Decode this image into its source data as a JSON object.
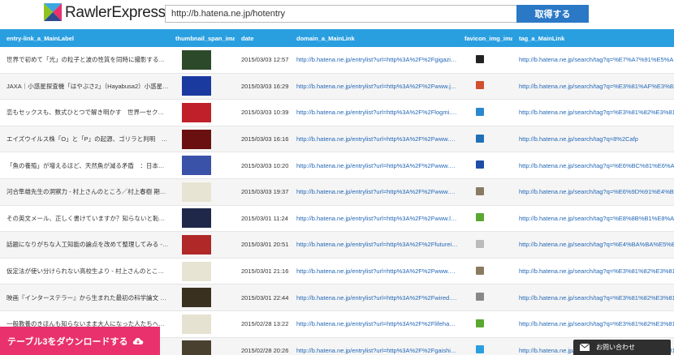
{
  "app": {
    "logo_text": "RawlerExpress",
    "logo_colors": [
      "#3aa7e0",
      "#e8316d",
      "#2d4b8e",
      "#8fc31f"
    ]
  },
  "search": {
    "url_value": "http://b.hatena.ne.jp/hotentry",
    "button_label": "取得する"
  },
  "table": {
    "columns": [
      "entry-link_a_MainLabel",
      "thumbnail_span_image",
      "date",
      "domain_a_MainLink",
      "favicon_img_image",
      "tag_a_MainLink"
    ],
    "rows": [
      {
        "label": "世界で初めて「光」の粒子と波の性質を同時に撮影することに成...",
        "thumb_color": "#2c4a2a",
        "date": "2015/03/03 12:57",
        "domain": "http://b.hatena.ne.jp/entrylist?url=http%3A%2F%2Fgigazine...",
        "favicon_icon": "gigazine-icon",
        "favicon_color": "#222222",
        "tag": "http://b.hatena.ne.jp/search/tag?q=%E7%A7%91%E5%AD%A6"
      },
      {
        "label": "JAXA｜小惑星探査機「はやぶさ2」（Hayabusa2）小惑星1999 ...",
        "thumb_color": "#1a3aa0",
        "date": "2015/03/03 16:29",
        "domain": "http://b.hatena.ne.jp/entrylist?url=http%3A%2F%2Fwww.jax...",
        "favicon_icon": "rocket-icon",
        "favicon_color": "#d05030",
        "tag": "http://b.hatena.ne.jp/search/tag?q=%E3%81%AF%E3%82%84"
      },
      {
        "label": "恋もセックスも、数式ひとつで解き明かす　世界一セクシーな数...",
        "thumb_color": "#c0202a",
        "date": "2015/03/03 10:39",
        "domain": "http://b.hatena.ne.jp/entrylist?url=http%3A%2F%2Flogmi.jp...",
        "favicon_icon": "logmi-icon",
        "favicon_color": "#2a88d0",
        "tag": "http://b.hatena.ne.jp/search/tag?q=%E3%81%82%E3%81%A8"
      },
      {
        "label": "エイズウイルス株「O」と「P」の起源、ゴリラと判明　写真1枚...",
        "thumb_color": "#6a1010",
        "date": "2015/03/03 16:16",
        "domain": "http://b.hatena.ne.jp/entrylist?url=http%3A%2F%2Fwww.afp...",
        "favicon_icon": "afp-icon",
        "favicon_color": "#1f6fb8",
        "tag": "http://b.hatena.ne.jp/search/tag?q=8%2Cafp"
      },
      {
        "label": "「魚の養殖」が増えるほど、天然魚が減る矛盾　：日本経済新聞",
        "thumb_color": "#3a52a8",
        "date": "2015/03/03 10:20",
        "domain": "http://b.hatena.ne.jp/entrylist?url=http%3A%2F%2Fwww.nik...",
        "favicon_icon": "nikkei-icon",
        "favicon_color": "#1e4ea8",
        "tag": "http://b.hatena.ne.jp/search/tag?q=%E6%BC%81%E6%A5%AD"
      },
      {
        "label": "河合隼雄先生の洞察力 - 村上さんのところ／村上春樹 期間限定公...",
        "thumb_color": "#e8e4d4",
        "date": "2015/03/03 19:37",
        "domain": "http://b.hatena.ne.jp/entrylist?url=http%3A%2F%2Fwww.wel...",
        "favicon_icon": "cat-icon",
        "favicon_color": "#8a7a60",
        "tag": "http://b.hatena.ne.jp/search/tag?q=%E6%9D%91%E4%B8%8A"
      },
      {
        "label": "その英文メール、正しく書けていますか？知らないと恥をかく5つ...",
        "thumb_color": "#20284a",
        "date": "2015/03/01 11:24",
        "domain": "http://b.hatena.ne.jp/entrylist?url=http%3A%2F%2Fwww.life...",
        "favicon_icon": "lifehacker-icon",
        "favicon_color": "#5aa832",
        "tag": "http://b.hatena.ne.jp/search/tag?q=%E8%8B%B1%E8%AA%9E"
      },
      {
        "label": "話題になりがちな人工知能の論点を改めて整理してみる - FutureI...",
        "thumb_color": "#b02828",
        "date": "2015/03/01 20:51",
        "domain": "http://b.hatena.ne.jp/entrylist?url=http%3A%2F%2Ffuturein...",
        "favicon_icon": "document-icon",
        "favicon_color": "#bbbbbb",
        "tag": "http://b.hatena.ne.jp/search/tag?q=%E4%BA%BA%E5%B7%A5"
      },
      {
        "label": "仮定法が使い分けられない高校生より - 村上さんのところ／村上...",
        "thumb_color": "#e8e4d4",
        "date": "2015/03/01 21:16",
        "domain": "http://b.hatena.ne.jp/entrylist?url=http%3A%2F%2Fwww.wel...",
        "favicon_icon": "cat-icon",
        "favicon_color": "#8a7a60",
        "tag": "http://b.hatena.ne.jp/search/tag?q=%E3%81%82%E3%81%A8"
      },
      {
        "label": "映画『インターステラー』から生まれた最初の科学論文 « WIRED.jp",
        "thumb_color": "#3a3020",
        "date": "2015/03/01 22:44",
        "domain": "http://b.hatena.ne.jp/entrylist?url=http%3A%2F%2Fwired.jp...",
        "favicon_icon": "wired-icon",
        "favicon_color": "#888888",
        "tag": "http://b.hatena.ne.jp/search/tag?q=%E3%81%82%E3%81%A8"
      },
      {
        "label": "一般教養のきほんも知らないまま大人になった人たちへ｜ライフハッカー",
        "thumb_color": "#e6e2d2",
        "date": "2015/02/28 13:22",
        "domain": "http://b.hatena.ne.jp/entrylist?url=http%3A%2F%2Flifehack...",
        "favicon_icon": "lifehacker-icon",
        "favicon_color": "#5aa832",
        "tag": "http://b.hatena.ne.jp/search/tag?q=%E3%81%82%E3%81%A8"
      },
      {
        "label": "なぜ「エラーメッセージ」を読む力が必要なのか",
        "thumb_color": "#4a4030",
        "date": "2015/02/28 20:26",
        "domain": "http://b.hatena.ne.jp/entrylist?url=http%3A%2F%2Fgaishish...",
        "favicon_icon": "gaishi-icon",
        "favicon_color": "#2a9fe0",
        "tag": "http://b.hatena.ne.jp/search/tag?q=%E3%81%82%E3%81%A8"
      }
    ]
  },
  "overlay": {
    "download_label": "テーブル3をダウンロードする",
    "contact_label": "お問い合わせ"
  }
}
